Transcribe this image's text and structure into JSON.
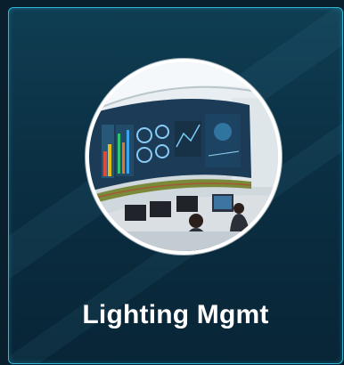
{
  "card": {
    "title": "Lighting Mgmt",
    "image_icon": "control-room-photo",
    "accent_border": "#2fb8d6"
  }
}
